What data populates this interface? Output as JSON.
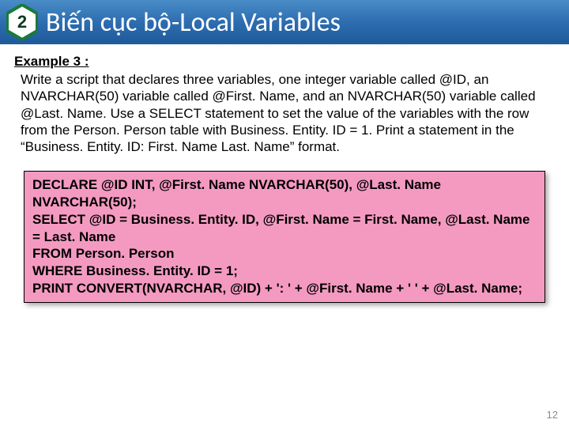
{
  "header": {
    "number": "2",
    "title": "Biến cục bộ-Local Variables"
  },
  "example": {
    "label": "Example 3 :",
    "body": "Write a script that declares three variables, one integer variable called @ID, an NVARCHAR(50) variable called @First. Name, and an NVARCHAR(50) variable called @Last. Name. Use a SELECT statement to set the value of the variables with the row from the Person. Person table with Business. Entity. ID = 1. Print a statement in the “Business. Entity. ID: First. Name Last. Name” format."
  },
  "code": "DECLARE @ID INT, @First. Name NVARCHAR(50), @Last. Name NVARCHAR(50);\nSELECT @ID = Business. Entity. ID, @First. Name = First. Name, @Last. Name = Last. Name\nFROM Person. Person\nWHERE Business. Entity. ID = 1;\nPRINT CONVERT(NVARCHAR, @ID) + ': ' + @First. Name + ' ' + @Last. Name;",
  "page_number": "12"
}
